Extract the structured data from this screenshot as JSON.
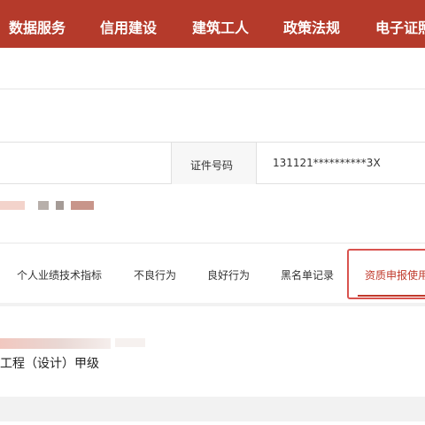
{
  "nav": {
    "items": [
      {
        "label": "数据服务"
      },
      {
        "label": "信用建设"
      },
      {
        "label": "建筑工人"
      },
      {
        "label": "政策法规"
      },
      {
        "label": "电子证照"
      }
    ]
  },
  "certificate": {
    "label": "证件号码",
    "value": "131121**********3X"
  },
  "tabs": [
    {
      "label": "个人业绩技术指标"
    },
    {
      "label": "不良行为"
    },
    {
      "label": "良好行为"
    },
    {
      "label": "黑名单记录"
    },
    {
      "label": "资质申报使用"
    }
  ],
  "content": {
    "qualification_text": "工程（设计）甲级"
  },
  "colors": {
    "nav_background": "#b53a2b",
    "accent": "#c0392b",
    "highlight_border": "#d9534f"
  }
}
